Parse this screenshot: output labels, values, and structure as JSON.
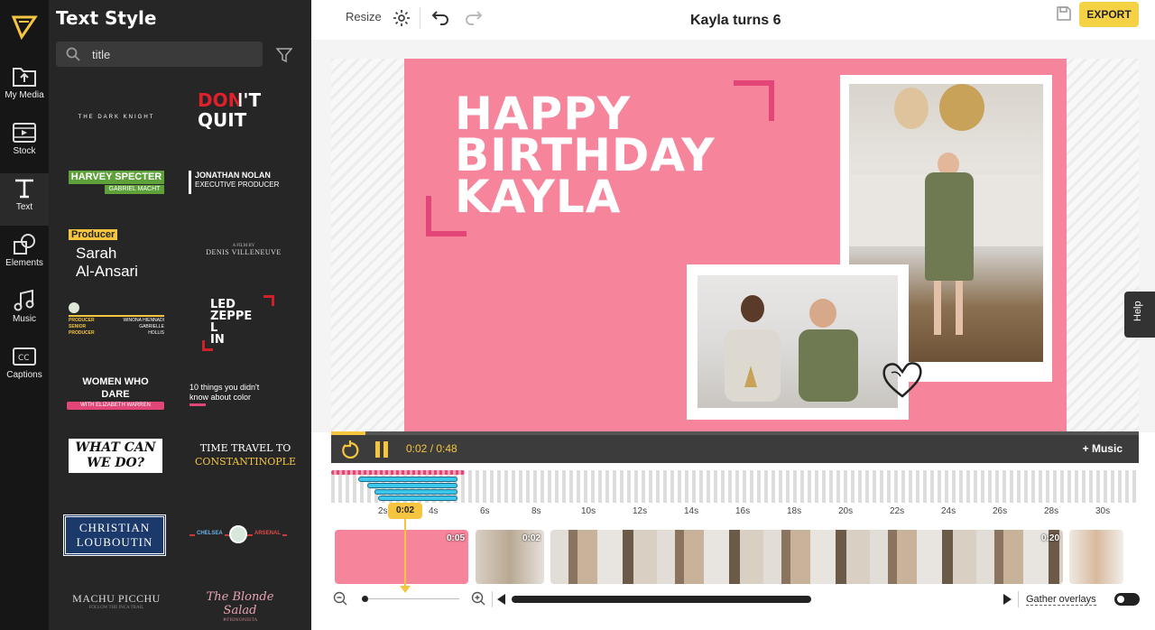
{
  "rail": {
    "items": [
      {
        "label": "My Media",
        "icon": "folder-upload-icon"
      },
      {
        "label": "Stock",
        "icon": "film-icon"
      },
      {
        "label": "Text",
        "icon": "text-icon"
      },
      {
        "label": "Elements",
        "icon": "shapes-icon"
      },
      {
        "label": "Music",
        "icon": "music-note-icon"
      },
      {
        "label": "Captions",
        "icon": "captions-icon"
      }
    ]
  },
  "panel": {
    "title": "Text Style",
    "search": {
      "value": "title",
      "placeholder": "Search"
    },
    "cards": [
      {
        "a": "THE DARK KNIGHT"
      },
      {
        "a": "DON'T",
        "b": "QUIT"
      },
      {
        "a": "HARVEY SPECTER",
        "b": "GABRIEL MACHT"
      },
      {
        "a": "JONATHAN NOLAN",
        "b": "EXECUTIVE PRODUCER"
      },
      {
        "a": "Producer",
        "b": "Sarah",
        "c": "Al-Ansari"
      },
      {
        "a": "A FILM BY",
        "b": "DENIS VILLENEUVE"
      },
      {
        "a": "PRODUCER",
        "b": "SENIOR",
        "c": "PRODUCER",
        "d": "WINONA HIENNADI",
        "e": "GABRIELLE",
        "f": "HOLLIS"
      },
      {
        "a": "LED",
        "b": "ZEPPE",
        "c": "L",
        "d": "IN"
      },
      {
        "a": "WOMEN WHO",
        "b": "DARE",
        "c": "WITH ELIZABETH WARREN"
      },
      {
        "a": "10 things you didn't",
        "b": "know about color"
      },
      {
        "a": "WHAT CAN",
        "b": "WE DO?"
      },
      {
        "a": "TIME TRAVEL TO",
        "b": "CONSTANTINOPLE"
      },
      {
        "a": "CHRISTIAN",
        "b": "LOUBOUTIN"
      },
      {
        "a": "CHELSEA",
        "b": "ARSENAL"
      },
      {
        "a": "MACHU PICCHU",
        "b": "FOLLOW THE INCA TRAIL"
      },
      {
        "a": "The Blonde Salad",
        "b": "#FRINONISTA"
      }
    ]
  },
  "topbar": {
    "resize": "Resize",
    "title": "Kayla turns 6",
    "export": "EXPORT"
  },
  "canvas": {
    "line1": "HAPPY",
    "line2": "BIRTHDAY",
    "line3": "KAYLA",
    "bg": "#f6859c",
    "accent": "#e14677"
  },
  "player": {
    "time": "0:02 / 0:48",
    "music": "+ Music",
    "progress": 0.042
  },
  "help": {
    "label": "Help"
  },
  "timeline": {
    "ticks": [
      "2s",
      "4s",
      "6s",
      "8s",
      "10s",
      "12s",
      "14s",
      "16s",
      "18s",
      "20s",
      "22s",
      "24s",
      "26s",
      "28s",
      "30s"
    ],
    "playhead": "0:02",
    "clips": [
      {
        "duration": "0:05"
      },
      {
        "duration": "0:02"
      },
      {
        "duration": "0:20"
      }
    ],
    "gather": "Gather overlays"
  }
}
